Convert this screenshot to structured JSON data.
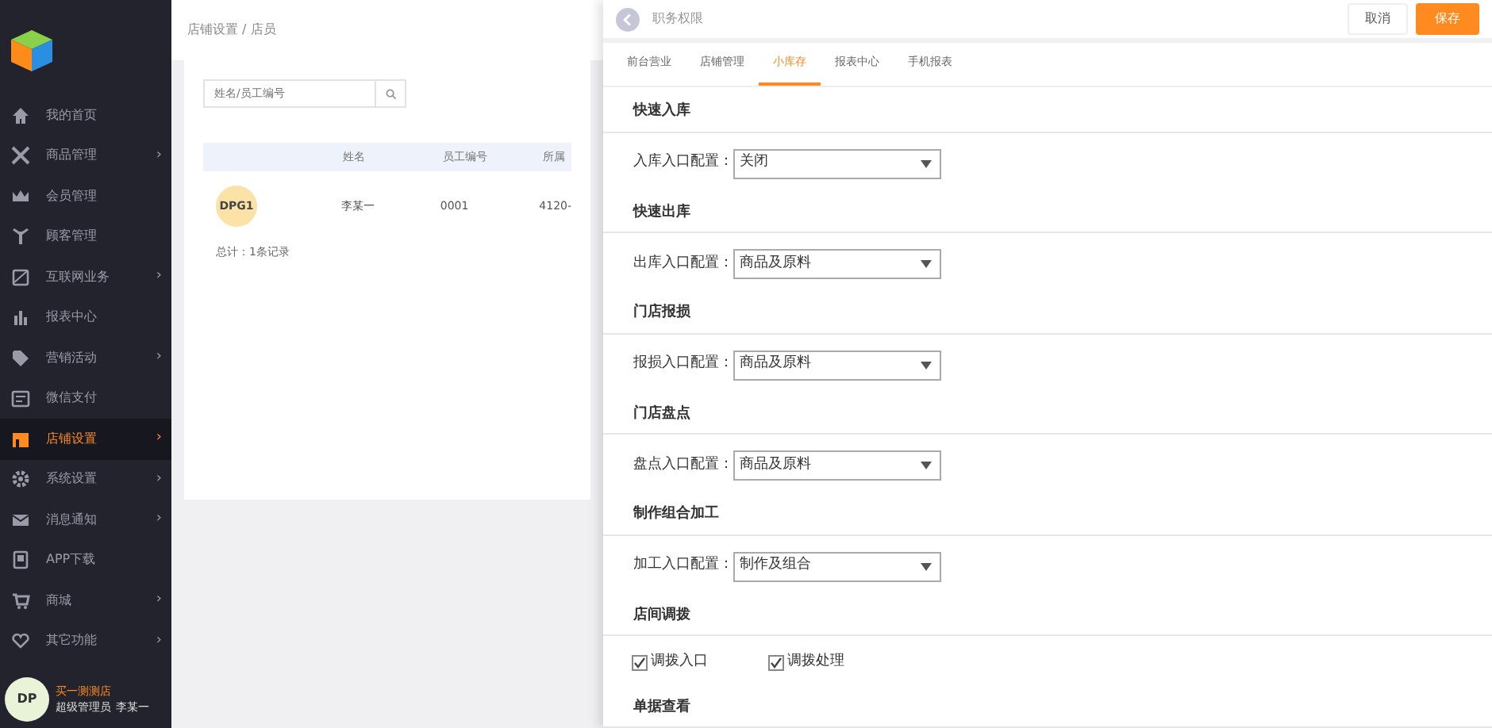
{
  "sidebar": {
    "items": [
      {
        "label": "我的首页",
        "selected": false
      },
      {
        "label": "商品管理",
        "chevron": "›",
        "selected": false
      },
      {
        "label": "会员管理",
        "selected": false
      },
      {
        "label": "顾客管理",
        "selected": false
      },
      {
        "label": "互联网业务",
        "chevron": "›",
        "selected": false
      },
      {
        "label": "报表中心",
        "selected": false
      },
      {
        "label": "营销活动",
        "chevron": "›",
        "selected": false
      },
      {
        "label": "微信支付",
        "selected": false
      },
      {
        "label": "店铺设置",
        "chevron": "›",
        "selected": true
      },
      {
        "label": "系统设置",
        "chevron": "›",
        "selected": false
      },
      {
        "label": "消息通知",
        "chevron": "›",
        "selected": false
      },
      {
        "label": "APP下载",
        "selected": false
      },
      {
        "label": "商城",
        "chevron": "›",
        "selected": false
      },
      {
        "label": "其它功能",
        "chevron": "›",
        "selected": false
      }
    ],
    "user": {
      "avatar": "DP",
      "shop": "买一测测店",
      "role": "超级管理员",
      "name": "李某一"
    }
  },
  "breadcrumb": "店铺设置 / 店员",
  "staff": {
    "search": {
      "placeholder": "姓名/员工编号"
    },
    "columns": [
      "姓名",
      "员工编号",
      "所属"
    ],
    "rows": [
      {
        "avatar": "DPG1",
        "cells": [
          "李某一",
          "0001",
          "4120-"
        ]
      }
    ],
    "total": "总计：1条记录"
  },
  "panel": {
    "title": "职务权限",
    "buttons": [
      {
        "label": "取消",
        "kind": "secondary"
      },
      {
        "label": "保存",
        "kind": "primary"
      }
    ],
    "tabs": [
      {
        "label": "前台营业",
        "selected": false
      },
      {
        "label": "店铺管理",
        "selected": false
      },
      {
        "label": "小库存",
        "selected": true
      },
      {
        "label": "报表中心",
        "selected": false
      },
      {
        "label": "手机报表",
        "selected": false
      }
    ],
    "sections": [
      {
        "heading": "快速入库",
        "kind": "select",
        "label": "入库入口配置：",
        "value": "关闭"
      },
      {
        "heading": "快速出库",
        "kind": "select",
        "label": "出库入口配置：",
        "value": "商品及原料"
      },
      {
        "heading": "门店报损",
        "kind": "select",
        "label": "报损入口配置：",
        "value": "商品及原料"
      },
      {
        "heading": "门店盘点",
        "kind": "select",
        "label": "盘点入口配置：",
        "value": "商品及原料"
      },
      {
        "heading": "制作组合加工",
        "kind": "select",
        "label": "加工入口配置：",
        "value": "制作及组合"
      },
      {
        "heading": "店间调拨",
        "kind": "checks",
        "options": [
          {
            "label": "调拨入口",
            "checked": true
          },
          {
            "label": "调拨处理",
            "checked": true
          }
        ]
      },
      {
        "heading": "单据查看",
        "kind": "none"
      }
    ]
  }
}
